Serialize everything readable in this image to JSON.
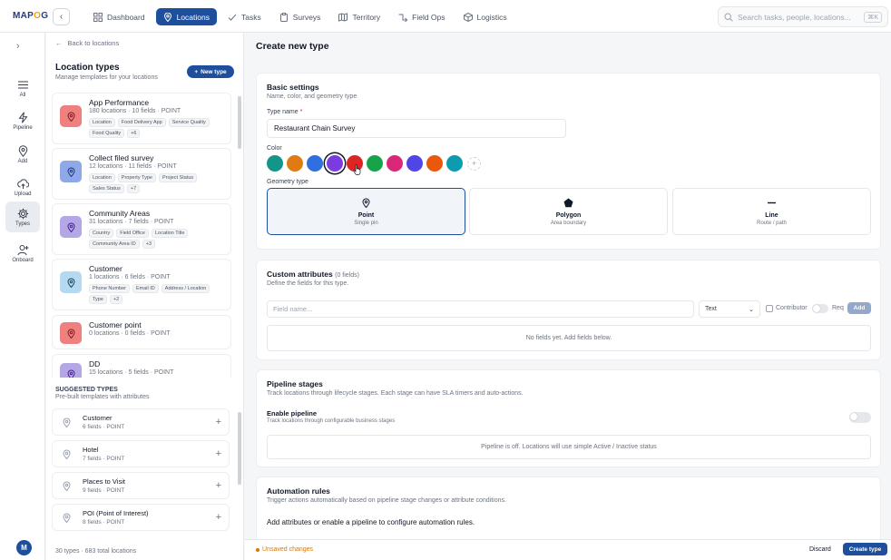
{
  "app": {
    "logo_prefix": "MAP",
    "logo_mid": "O",
    "logo_suffix": "G"
  },
  "nav": [
    {
      "label": "Dashboard",
      "icon": "grid-icon",
      "active": false
    },
    {
      "label": "Locations",
      "icon": "pin-icon",
      "active": true
    },
    {
      "label": "Tasks",
      "icon": "check-icon",
      "active": false
    },
    {
      "label": "Surveys",
      "icon": "clipboard-icon",
      "active": false
    },
    {
      "label": "Territory",
      "icon": "map-icon",
      "active": false
    },
    {
      "label": "Field Ops",
      "icon": "route-icon",
      "active": false
    },
    {
      "label": "Logistics",
      "icon": "box-icon",
      "active": false
    }
  ],
  "search": {
    "placeholder": "Search tasks, people, locations...",
    "shortcut": "⌘K"
  },
  "rail": [
    {
      "label": "All",
      "icon": "list-icon",
      "active": false
    },
    {
      "label": "Pipeline",
      "icon": "bolt-icon",
      "active": false
    },
    {
      "label": "Add",
      "icon": "pin-icon",
      "active": false
    },
    {
      "label": "Upload",
      "icon": "cloud-upload-icon",
      "active": false
    },
    {
      "label": "Types",
      "icon": "gear-icon",
      "active": true
    },
    {
      "label": "Onboard",
      "icon": "user-plus-icon",
      "active": false
    }
  ],
  "user": {
    "initial": "M"
  },
  "panel": {
    "back_label": "Back to locations",
    "title": "Location types",
    "subtitle": "Manage templates for your locations",
    "new_type_label": "New type",
    "footer": "30 types · 683 total locations"
  },
  "types": [
    {
      "name": "App Performance",
      "meta": "180 locations · 10 fields · POINT",
      "color": "#f08080",
      "tags": [
        "Location",
        "Food Delivery App",
        "Service Quality",
        "Food Quality",
        "+6"
      ]
    },
    {
      "name": "Collect filed survey",
      "meta": "12 locations · 11 fields · POINT",
      "color": "#8fa8e8",
      "tags": [
        "Location",
        "Property Type",
        "Project Status",
        "Sales Status",
        "+7"
      ]
    },
    {
      "name": "Community Areas",
      "meta": "31 locations · 7 fields · POINT",
      "color": "#b3a7e6",
      "tags": [
        "Country",
        "Field Office",
        "Location Title",
        "Community Area ID",
        "+3"
      ]
    },
    {
      "name": "Customer",
      "meta": "1 locations · 6 fields · POINT",
      "color": "#b5d9ef",
      "tags": [
        "Phone Number",
        "Email ID",
        "Address / Location",
        "Type",
        "+2"
      ]
    },
    {
      "name": "Customer point",
      "meta": "0 locations · 0 fields · POINT",
      "color": "#f08080",
      "tags": []
    },
    {
      "name": "DD",
      "meta": "15 locations · 5 fields · POINT",
      "color": "#b3a7e6",
      "tags": []
    }
  ],
  "suggested": {
    "header": "SUGGESTED TYPES",
    "subtitle": "Pre-built templates with attributes",
    "items": [
      {
        "name": "Customer",
        "meta": "6 fields · POINT"
      },
      {
        "name": "Hotel",
        "meta": "7 fields · POINT"
      },
      {
        "name": "Places to Visit",
        "meta": "9 fields · POINT"
      },
      {
        "name": "POI (Point of Interest)",
        "meta": "8 fields · POINT"
      }
    ]
  },
  "main": {
    "title": "Create new type",
    "basic": {
      "title": "Basic settings",
      "subtitle": "Name, color, and geometry type",
      "type_name_label": "Type name",
      "type_name_required": "*",
      "type_name_value": "Restaurant Chain Survey",
      "color_label": "Color",
      "colors": [
        "#14958a",
        "#e07b14",
        "#2f6fe0",
        "#7a3ce0",
        "#dc2626",
        "#16a34a",
        "#db2777",
        "#4f46e5",
        "#ea580c",
        "#0e9bb0"
      ],
      "selected_color_index": 3,
      "geometry_label": "Geometry type",
      "geometry": [
        {
          "name": "Point",
          "sub": "Single pin",
          "icon": "pin-icon"
        },
        {
          "name": "Polygon",
          "sub": "Area boundary",
          "icon": "pentagon-icon"
        },
        {
          "name": "Line",
          "sub": "Route / path",
          "icon": "line-icon"
        }
      ],
      "selected_geometry": "Point"
    },
    "attributes": {
      "title": "Custom attributes",
      "count": "(0 fields)",
      "subtitle": "Define the fields for this type.",
      "field_placeholder": "Field name...",
      "type_value": "Text",
      "contributor_label": "Contributor",
      "req_label": "Req",
      "add_label": "Add",
      "empty_text": "No fields yet. Add fields below."
    },
    "pipeline": {
      "title": "Pipeline stages",
      "subtitle": "Track locations through lifecycle stages. Each stage can have SLA timers and auto-actions.",
      "enable_label": "Enable pipeline",
      "enable_sub": "Track locations through configurable business stages",
      "off_text": "Pipeline is off. Locations will use simple Active / Inactive status"
    },
    "automation": {
      "title": "Automation rules",
      "subtitle": "Trigger actions automatically based on pipeline stage changes or attribute conditions.",
      "empty_text": "Add attributes or enable a pipeline to configure automation rules."
    }
  },
  "footer_bar": {
    "unsaved": "Unsaved changes",
    "discard": "Discard",
    "create": "Create type"
  }
}
